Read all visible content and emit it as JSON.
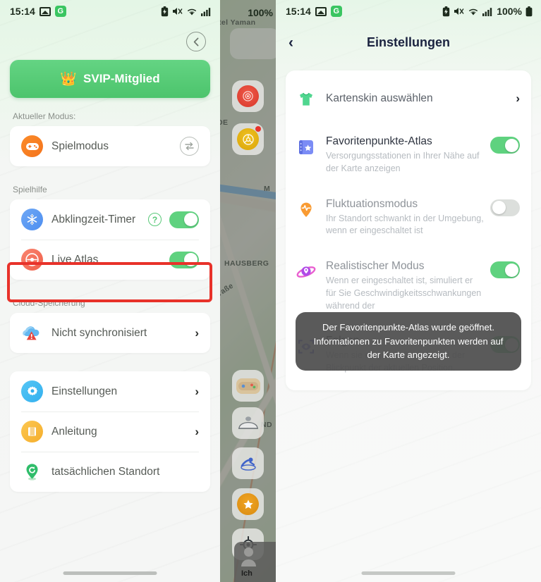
{
  "status_bar": {
    "time": "15:14",
    "battery_text": "100%",
    "icons": [
      "image-icon",
      "app-g-icon",
      "battery-saver-icon",
      "mute-icon",
      "wifi-icon",
      "signal-icon",
      "battery-icon"
    ],
    "app_badge_letter": "G"
  },
  "left_panel": {
    "vip_banner": {
      "label": "SVIP-Mitglied",
      "crown": "👑"
    },
    "current_mode_label": "Aktueller Modus:",
    "current_mode": {
      "name": "Spielmodus",
      "icon": "gamepad-icon",
      "swap_icon": "swap-icon"
    },
    "game_help_label": "Spielhilfe",
    "game_help_items": [
      {
        "label": "Abklingzeit-Timer",
        "icon": "snowflake-icon",
        "has_help": true,
        "help_glyph": "?",
        "toggle": "on"
      },
      {
        "label": "Live Atlas",
        "icon": "live-atlas-icon",
        "has_help": false,
        "toggle": "on",
        "highlighted": true
      }
    ],
    "cloud_label": "Cloud-Speicherung",
    "cloud_item": {
      "label": "Nicht synchronisiert",
      "icon": "cloud-warning-icon",
      "chevron": "›"
    },
    "menu_items": [
      {
        "label": "Einstellungen",
        "icon": "gear-icon",
        "chevron": "›"
      },
      {
        "label": "Anleitung",
        "icon": "book-icon",
        "chevron": "›"
      },
      {
        "label": "tatsächlichen Standort",
        "icon": "location-pin-icon",
        "chevron": ""
      }
    ]
  },
  "map_panel": {
    "labels": [
      "tel Yaman",
      "DE",
      "M",
      "HAUSBERG",
      "raße",
      "ND"
    ],
    "buttons": [
      {
        "name": "radar-red-icon",
        "badge": false
      },
      {
        "name": "steering-wheel-icon",
        "badge": true
      },
      {
        "name": "gamepad-map-icon",
        "badge": false
      },
      {
        "name": "vehicle-icon",
        "badge": false
      },
      {
        "name": "swimmer-icon",
        "badge": false
      },
      {
        "name": "star-favorite-icon",
        "badge": false
      },
      {
        "name": "locate-me-icon",
        "badge": false
      }
    ],
    "me_label": "Ich"
  },
  "right_panel": {
    "title": "Einstellungen",
    "back_icon": "‹",
    "items": [
      {
        "name": "Kartenskin auswählen",
        "desc": "",
        "icon": "tshirt-icon",
        "control": "chevron",
        "chevron": "›",
        "muted": false
      },
      {
        "name": "Favoritenpunkte-Atlas",
        "desc": "Versorgungsstationen in Ihrer Nähe auf der Karte anzeigen",
        "icon": "atlas-book-icon",
        "control": "toggle",
        "toggle": "on",
        "muted": false
      },
      {
        "name": "Fluktuationsmodus",
        "desc": "Ihr Standort schwankt in der Umgebung, wenn er eingeschaltet ist",
        "icon": "pulse-pin-icon",
        "control": "toggle",
        "toggle": "off",
        "muted": true
      },
      {
        "name": "Realistischer Modus",
        "desc": "Wenn er eingeschaltet ist, simuliert er für Sie Geschwindigkeitsschwankungen während der",
        "icon": "planet-icon",
        "control": "toggle",
        "toggle": "on",
        "muted": true
      },
      {
        "name": "Folgen",
        "desc": "Wenn sie eingeschaltet ist, folgt der Blickpunkt der aktuellen Position.",
        "icon": "eye-focus-icon",
        "control": "toggle",
        "toggle": "on",
        "muted": false
      }
    ],
    "toast": "Der Favoritenpunkte-Atlas wurde geöffnet. Informationen zu Favoritenpunkten werden auf der Karte angezeigt."
  },
  "colors": {
    "accent_green": "#5fd27f",
    "banner_green": "#4cc46c",
    "highlight_red": "#e8322a",
    "orange": "#f57b20",
    "blue": "#3fb6f0",
    "yellow": "#f5b93c",
    "purple": "#7b68ee"
  }
}
